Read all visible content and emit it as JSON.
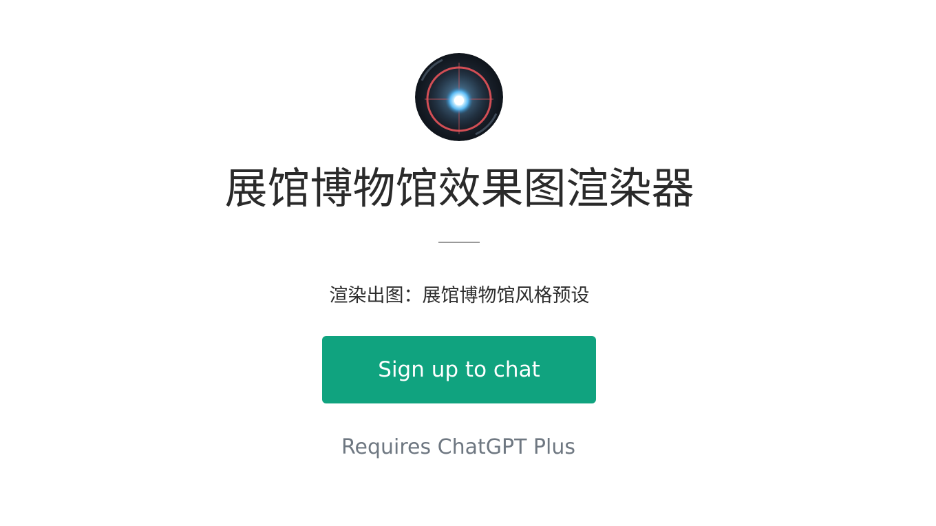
{
  "gpt": {
    "avatar_icon": "glowing-orb-target-icon",
    "title": "展馆博物馆效果图渲染器",
    "divider_text": "——",
    "description": "渲染出图：展馆博物馆风格预设"
  },
  "actions": {
    "signup_label": "Sign up to chat"
  },
  "footer": {
    "requires_note": "Requires ChatGPT Plus"
  },
  "colors": {
    "accent": "#10a37f",
    "title_text": "#2a2a2a",
    "muted_text": "#6e7781",
    "background": "#ffffff"
  }
}
